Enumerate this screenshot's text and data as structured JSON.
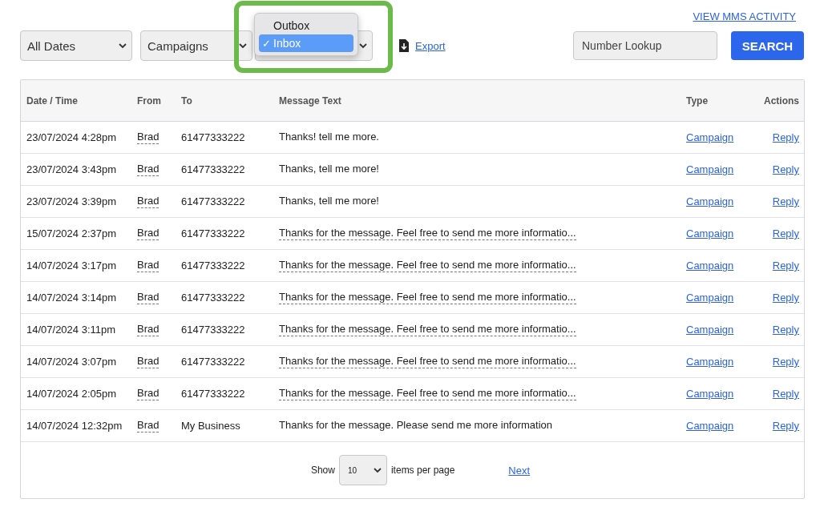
{
  "top_link": "VIEW MMS ACTIVITY",
  "filters": [
    {
      "value": "All Dates"
    },
    {
      "value": "Campaigns"
    },
    {
      "covered": true
    }
  ],
  "open_menu": {
    "highlighted": true,
    "options": [
      {
        "label": "Outbox",
        "selected": false
      },
      {
        "label": "Inbox",
        "selected": true
      }
    ],
    "check_mark": "✓"
  },
  "export_link": "Export",
  "number_lookup": {
    "placeholder": "Number Lookup"
  },
  "search_button": "SEARCH",
  "table": {
    "columns": [
      "Date / Time",
      "From",
      "To",
      "Message Text",
      "Type",
      "Actions"
    ],
    "rows": [
      {
        "date": "23/07/2024 4:28pm",
        "from": "Brad",
        "to": "61477333222",
        "message": "Thanks! tell me more.",
        "truncated": false,
        "type": "Campaign",
        "action": "Reply"
      },
      {
        "date": "23/07/2024 3:43pm",
        "from": "Brad",
        "to": "61477333222",
        "message": "Thanks, tell me more!",
        "truncated": false,
        "type": "Campaign",
        "action": "Reply"
      },
      {
        "date": "23/07/2024 3:39pm",
        "from": "Brad",
        "to": "61477333222",
        "message": "Thanks, tell me more!",
        "truncated": false,
        "type": "Campaign",
        "action": "Reply"
      },
      {
        "date": "15/07/2024 2:37pm",
        "from": "Brad",
        "to": "61477333222",
        "message": "Thanks for the message. Feel free to send me more informatio...",
        "truncated": true,
        "type": "Campaign",
        "action": "Reply"
      },
      {
        "date": "14/07/2024 3:17pm",
        "from": "Brad",
        "to": "61477333222",
        "message": "Thanks for the message. Feel free to send me more informatio...",
        "truncated": true,
        "type": "Campaign",
        "action": "Reply"
      },
      {
        "date": "14/07/2024 3:14pm",
        "from": "Brad",
        "to": "61477333222",
        "message": "Thanks for the message. Feel free to send me more informatio...",
        "truncated": true,
        "type": "Campaign",
        "action": "Reply"
      },
      {
        "date": "14/07/2024 3:11pm",
        "from": "Brad",
        "to": "61477333222",
        "message": "Thanks for the message. Feel free to send me more informatio...",
        "truncated": true,
        "type": "Campaign",
        "action": "Reply"
      },
      {
        "date": "14/07/2024 3:07pm",
        "from": "Brad",
        "to": "61477333222",
        "message": "Thanks for the message. Feel free to send me more informatio...",
        "truncated": true,
        "type": "Campaign",
        "action": "Reply"
      },
      {
        "date": "14/07/2024 2:05pm",
        "from": "Brad",
        "to": "61477333222",
        "message": "Thanks for the message. Feel free to send me more informatio...",
        "truncated": true,
        "type": "Campaign",
        "action": "Reply"
      },
      {
        "date": "14/07/2024 12:32pm",
        "from": "Brad",
        "to": "My Business",
        "message": "Thanks for the message. Please send me more information",
        "truncated": false,
        "type": "Campaign",
        "action": "Reply"
      }
    ]
  },
  "pagination": {
    "show_label": "Show",
    "page_size": "10",
    "per_page_label": "items per page",
    "next": "Next"
  }
}
